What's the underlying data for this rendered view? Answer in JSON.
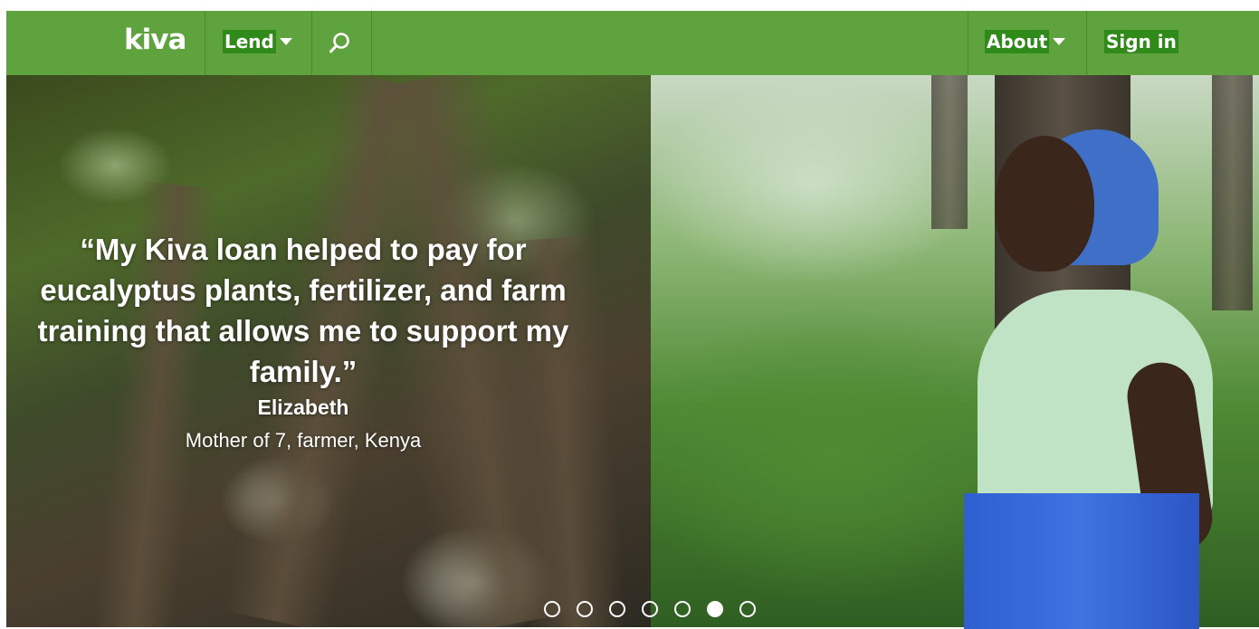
{
  "header": {
    "logo": "kiva",
    "lend_label": "Lend",
    "about_label": "About",
    "signin_label": "Sign in",
    "brand_color": "#5fa33e",
    "highlight_color": "#2f8a1a"
  },
  "hero": {
    "quote": "“My Kiva loan helped to pay for eucalyptus plants, fertilizer, and farm training that allows me to support my family.”",
    "name": "Elizabeth",
    "description": "Mother of 7, farmer, Kenya"
  },
  "carousel": {
    "slide_count": 7,
    "active_index": 5
  }
}
